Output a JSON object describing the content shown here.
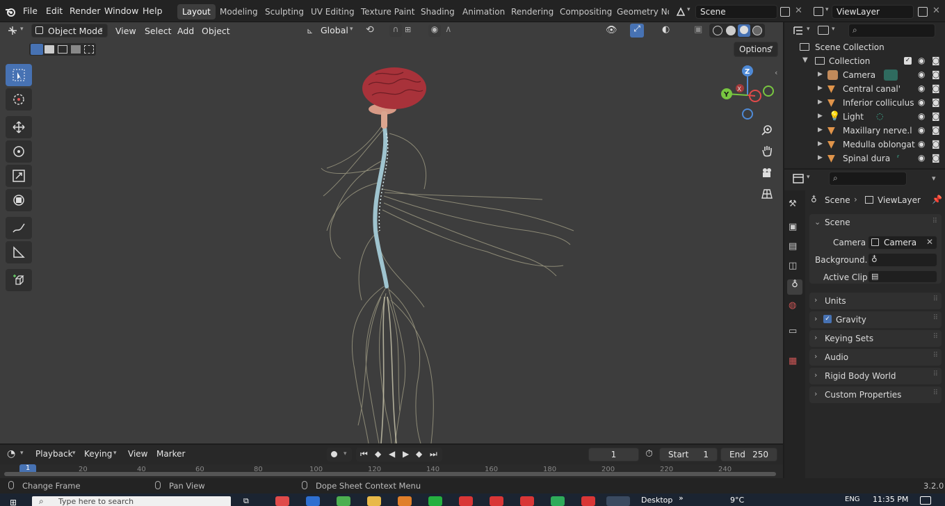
{
  "topbar": {
    "menu": [
      "File",
      "Edit",
      "Render",
      "Window",
      "Help"
    ],
    "workspaces": [
      "Layout",
      "Modeling",
      "Sculpting",
      "UV Editing",
      "Texture Paint",
      "Shading",
      "Animation",
      "Rendering",
      "Compositing",
      "Geometry Noc"
    ],
    "scene_value": "Scene",
    "viewlayer_value": "ViewLayer"
  },
  "viewport_header": {
    "mode": "Object Mode",
    "menus": [
      "View",
      "Select",
      "Add",
      "Object"
    ],
    "orientation": "Global",
    "options_label": "Options"
  },
  "outliner": {
    "root": "Scene Collection",
    "collection": "Collection",
    "items": [
      "Camera",
      "Central canal'",
      "Inferior colliculus",
      "Light",
      "Maxillary nerve.l",
      "Medulla oblongat",
      "Spinal dura"
    ]
  },
  "properties": {
    "breadcrumb": {
      "scene": "Scene",
      "viewlayer": "ViewLayer"
    },
    "scene_panel": "Scene",
    "camera_label": "Camera",
    "camera_value": "Camera",
    "background_label": "Background...",
    "active_clip_label": "Active Clip",
    "panels": [
      "Units",
      "Gravity",
      "Keying Sets",
      "Audio",
      "Rigid Body World",
      "Custom Properties"
    ],
    "gravity_enabled": true
  },
  "timeline": {
    "menus": [
      "Playback",
      "Keying",
      "View",
      "Marker"
    ],
    "current_frame": "1",
    "start_label": "Start",
    "start_value": "1",
    "end_label": "End",
    "end_value": "250",
    "ruler": [
      "1",
      "20",
      "40",
      "60",
      "80",
      "100",
      "120",
      "140",
      "160",
      "180",
      "200",
      "220",
      "240"
    ]
  },
  "statusbar": {
    "left": "Change Frame",
    "middle": "Pan View",
    "right": "Dope Sheet Context Menu",
    "version": "3.2.0"
  },
  "taskbar": {
    "search_placeholder": "Type here to search",
    "desktop_label": "Desktop",
    "weather": "9°C",
    "lang": "ENG",
    "time": "11:35 PM"
  },
  "colors": {
    "accent": "#4772b3",
    "brain": "#a8323a",
    "spinal": "#9fc4cf",
    "nerves": "#a8a48a"
  }
}
